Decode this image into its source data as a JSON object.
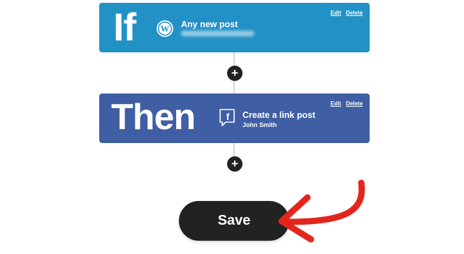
{
  "if_block": {
    "keyword": "If",
    "service_icon": "wordpress-icon",
    "trigger_title": "Any new post",
    "edit_label": "Edit",
    "delete_label": "Delete",
    "color": "#2191c6"
  },
  "then_block": {
    "keyword": "Then",
    "service_icon": "facebook-icon",
    "action_title": "Create a link post",
    "account": "John Smith",
    "edit_label": "Edit",
    "delete_label": "Delete",
    "color": "#3f5ea3"
  },
  "add_step_label": "+",
  "save_label": "Save",
  "annotation": {
    "icon": "red-arrow-icon",
    "color": "#e3261d"
  }
}
